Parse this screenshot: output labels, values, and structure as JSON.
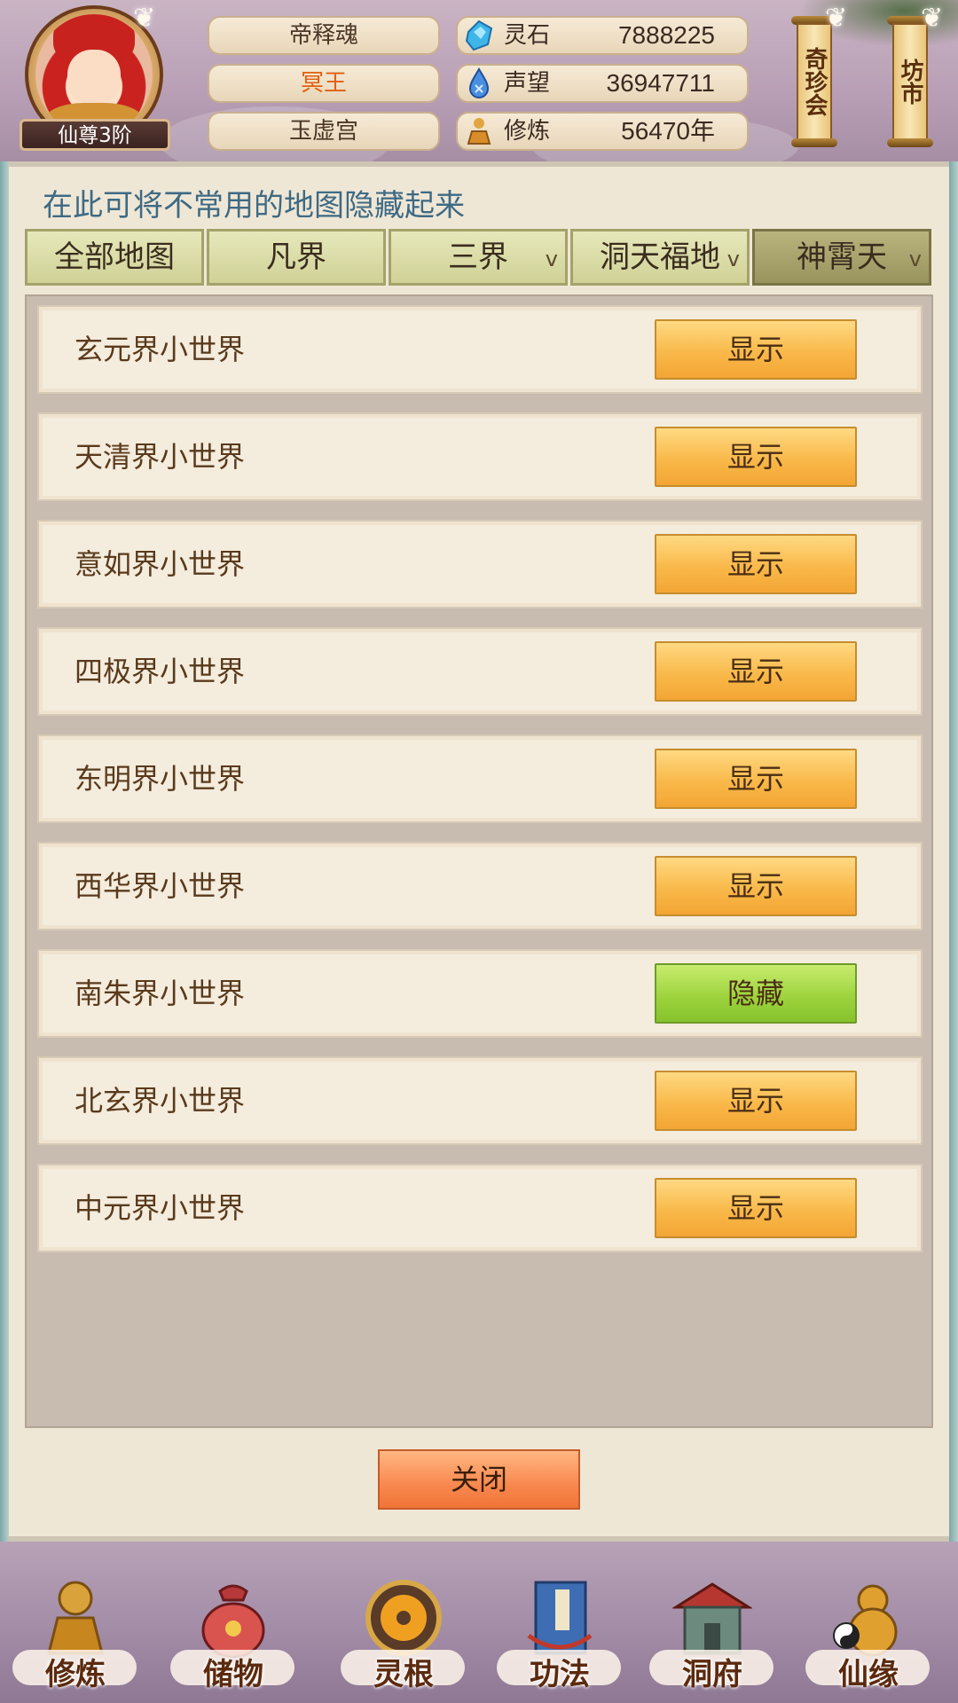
{
  "header": {
    "rank_badge": "仙尊3阶",
    "player_name": "帝释魂",
    "player_title": "冥王",
    "sect": "玉虚宫",
    "stats": [
      {
        "label": "灵石",
        "value": "7888225",
        "icon": "spirit-stone-icon"
      },
      {
        "label": "声望",
        "value": "36947711",
        "icon": "prestige-icon"
      },
      {
        "label": "修炼",
        "value": "56470年",
        "icon": "cultivation-icon"
      }
    ],
    "scrolls": [
      {
        "label": "奇珍会"
      },
      {
        "label": "坊市"
      }
    ]
  },
  "panel": {
    "hint": "在此可将不常用的地图隐藏起来",
    "tabs": [
      {
        "label": "全部地图",
        "dropdown": false
      },
      {
        "label": "凡界",
        "dropdown": false
      },
      {
        "label": "三界",
        "dropdown": true
      },
      {
        "label": "洞天福地",
        "dropdown": true
      },
      {
        "label": "神霄天",
        "dropdown": true,
        "active": true
      }
    ],
    "dropdown_glyph": "v",
    "maps": [
      {
        "name": "玄元界小世界",
        "action": "显示",
        "state": "show"
      },
      {
        "name": "天清界小世界",
        "action": "显示",
        "state": "show"
      },
      {
        "name": "意如界小世界",
        "action": "显示",
        "state": "show"
      },
      {
        "name": "四极界小世界",
        "action": "显示",
        "state": "show"
      },
      {
        "name": "东明界小世界",
        "action": "显示",
        "state": "show"
      },
      {
        "name": "西华界小世界",
        "action": "显示",
        "state": "show"
      },
      {
        "name": "南朱界小世界",
        "action": "隐藏",
        "state": "hide"
      },
      {
        "name": "北玄界小世界",
        "action": "显示",
        "state": "show"
      },
      {
        "name": "中元界小世界",
        "action": "显示",
        "state": "show"
      }
    ],
    "close_label": "关闭"
  },
  "nav": [
    {
      "label": "修炼",
      "icon": "meditating-figure-icon"
    },
    {
      "label": "储物",
      "icon": "treasure-bag-icon"
    },
    {
      "label": "灵根",
      "icon": "spirit-root-orb-icon"
    },
    {
      "label": "功法",
      "icon": "scripture-book-icon"
    },
    {
      "label": "洞府",
      "icon": "cave-dwelling-icon"
    },
    {
      "label": "仙缘",
      "icon": "gourd-yinyang-icon"
    }
  ],
  "colors": {
    "show_button": "#f9b94a",
    "hide_button": "#9ed43e",
    "close_button": "#f8884f",
    "hint_text": "#3e6a84",
    "title_text": "#e1600e"
  }
}
